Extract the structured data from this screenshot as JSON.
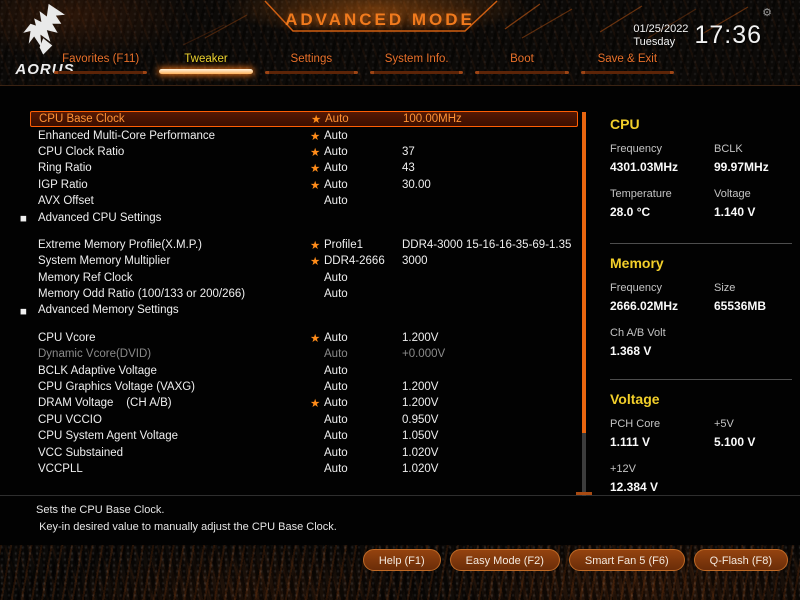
{
  "header": {
    "title": "ADVANCED MODE",
    "brand": "AORUS",
    "date": "01/25/2022",
    "weekday": "Tuesday",
    "time": "17:36"
  },
  "icons": {
    "gear": "⚙",
    "star": "★",
    "submenu_bullet": "■"
  },
  "tabs": [
    {
      "label": "Favorites (F11)",
      "name": "tab-favorites",
      "active": false
    },
    {
      "label": "Tweaker",
      "name": "tab-tweaker",
      "active": true
    },
    {
      "label": "Settings",
      "name": "tab-settings",
      "active": false
    },
    {
      "label": "System Info.",
      "name": "tab-system-info",
      "active": false
    },
    {
      "label": "Boot",
      "name": "tab-boot",
      "active": false
    },
    {
      "label": "Save & Exit",
      "name": "tab-save-exit",
      "active": false
    }
  ],
  "settings_rows": [
    {
      "label": "CPU Base Clock",
      "star": true,
      "value": "Auto",
      "extra": "100.00MHz",
      "selected": true
    },
    {
      "label": "Enhanced Multi-Core Performance",
      "star": true,
      "value": "Auto",
      "extra": ""
    },
    {
      "label": "CPU Clock Ratio",
      "star": true,
      "value": "Auto",
      "extra": "37"
    },
    {
      "label": "Ring Ratio",
      "star": true,
      "value": "Auto",
      "extra": "43"
    },
    {
      "label": "IGP Ratio",
      "star": true,
      "value": "Auto",
      "extra": "30.00"
    },
    {
      "label": "AVX Offset",
      "star": false,
      "value": "Auto",
      "extra": ""
    },
    {
      "label": "Advanced CPU Settings",
      "submenu": true
    },
    {
      "spacer": true
    },
    {
      "label": "Extreme Memory Profile(X.M.P.)",
      "star": true,
      "value": "Profile1",
      "extra": "DDR4-3000 15-16-16-35-69-1.35"
    },
    {
      "label": "System Memory Multiplier",
      "star": true,
      "value": "DDR4-2666",
      "extra": "3000"
    },
    {
      "label": "Memory Ref Clock",
      "star": false,
      "value": "Auto",
      "extra": ""
    },
    {
      "label": "Memory Odd Ratio (100/133 or 200/266)",
      "star": false,
      "value": "Auto",
      "extra": ""
    },
    {
      "label": "Advanced Memory Settings",
      "submenu": true
    },
    {
      "spacer": true
    },
    {
      "label": "CPU Vcore",
      "star": true,
      "value": "Auto",
      "extra": "1.200V"
    },
    {
      "label": "Dynamic Vcore(DVID)",
      "star": false,
      "value": "Auto",
      "extra": "+0.000V",
      "disabled": true
    },
    {
      "label": "BCLK Adaptive Voltage",
      "star": false,
      "value": "Auto",
      "extra": ""
    },
    {
      "label": "CPU Graphics Voltage (VAXG)",
      "star": false,
      "value": "Auto",
      "extra": "1.200V"
    },
    {
      "label": "DRAM Voltage    (CH A/B)",
      "star": true,
      "value": "Auto",
      "extra": "1.200V"
    },
    {
      "label": "CPU VCCIO",
      "star": false,
      "value": "Auto",
      "extra": "0.950V"
    },
    {
      "label": "CPU System Agent Voltage",
      "star": false,
      "value": "Auto",
      "extra": "1.050V"
    },
    {
      "label": "VCC Substained",
      "star": false,
      "value": "Auto",
      "extra": "1.020V"
    },
    {
      "label": "VCCPLL",
      "star": false,
      "value": "Auto",
      "extra": "1.020V"
    }
  ],
  "sidebar_sections": [
    {
      "title": "CPU",
      "name": "cpu-monitor-panel",
      "pairs": [
        {
          "label": "Frequency",
          "value": "4301.03MHz"
        },
        {
          "label": "BCLK",
          "value": "99.97MHz"
        },
        {
          "label": "Temperature",
          "value": "28.0 °C"
        },
        {
          "label": "Voltage",
          "value": "1.140 V"
        }
      ]
    },
    {
      "title": "Memory",
      "name": "memory-monitor-panel",
      "pairs": [
        {
          "label": "Frequency",
          "value": "2666.02MHz"
        },
        {
          "label": "Size",
          "value": "65536MB"
        },
        {
          "label": "Ch A/B Volt",
          "value": "1.368 V"
        }
      ]
    },
    {
      "title": "Voltage",
      "name": "voltage-monitor-panel",
      "pairs": [
        {
          "label": "PCH Core",
          "value": "1.111 V"
        },
        {
          "label": "+5V",
          "value": "5.100 V"
        },
        {
          "label": "+12V",
          "value": "12.384 V"
        }
      ]
    }
  ],
  "help": {
    "line1": "Sets the CPU Base Clock.",
    "line2": " Key-in desired value to manually adjust the CPU Base Clock."
  },
  "footer_buttons": [
    {
      "label": "Help (F1)",
      "name": "help-button"
    },
    {
      "label": "Easy Mode (F2)",
      "name": "easy-mode-button"
    },
    {
      "label": "Smart Fan 5 (F6)",
      "name": "smart-fan-button"
    },
    {
      "label": "Q-Flash (F8)",
      "name": "q-flash-button"
    }
  ]
}
